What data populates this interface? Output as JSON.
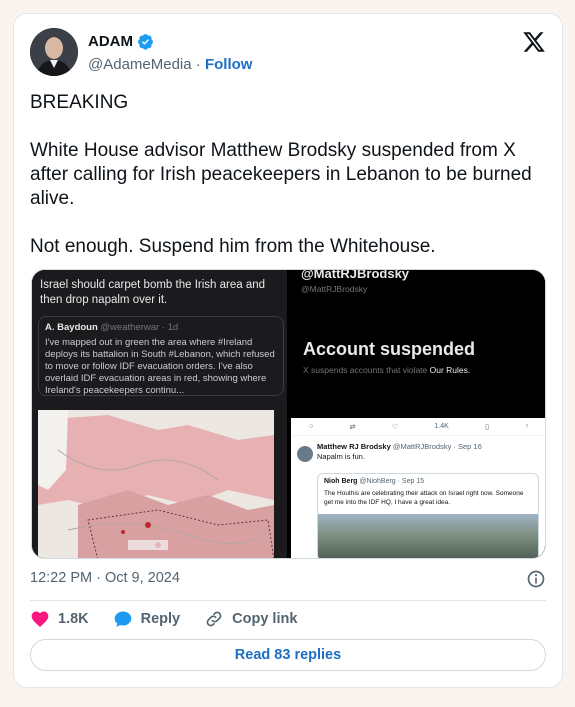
{
  "author": {
    "display_name": "ADAM",
    "handle": "@AdameMedia",
    "separator": "·",
    "follow_label": "Follow"
  },
  "tweet": {
    "paragraphs": [
      "BREAKING",
      "White House advisor Matthew Brodsky suspended from X after calling for Irish peacekeepers in Lebanon to be burned alive.",
      "Not enough. Suspend him from the Whitehouse."
    ],
    "timestamp": "12:22 PM · Oct 9, 2024"
  },
  "media": {
    "left": {
      "headline": "Israel should carpet bomb the Irish area and then drop napalm over it.",
      "quote_name": "A. Baydoun",
      "quote_handle": "@weatherwar · 1d",
      "quote_text": "I've mapped out in green the area where #Ireland deploys its battalion in South #Lebanon, which refused to move or follow IDF evacuation orders. I've also overlaid IDF evacuation areas in red, showing where Ireland's peacekeepers continu..."
    },
    "right": {
      "handle": "@MattRJBrodsky",
      "sub_handle": "@MattRJBrodsky",
      "title": "Account suspended",
      "desc_prefix": "X suspends accounts that violate ",
      "desc_link": "Our Rules.",
      "like_count": "1.4K",
      "post_name": "Matthew RJ Brodsky",
      "post_meta": "@MattRJBrodsky · Sep 16",
      "post_text": "Napalm is fun.",
      "quote_name": "Nioh Berg",
      "quote_meta": "@NiohBerg · Sep 15",
      "quote_text": "The Houthis are celebrating their attack on Israel right now. Someone get me into the IDF HQ, I have a great idea."
    }
  },
  "actions": {
    "like_count": "1.8K",
    "reply_label": "Reply",
    "copy_link_label": "Copy link",
    "read_replies_label": "Read 83 replies"
  },
  "colors": {
    "accent": "#1d6fc4",
    "like": "#f91880",
    "verified": "#1d9bf0",
    "page_bg": "#fbf3ee"
  }
}
